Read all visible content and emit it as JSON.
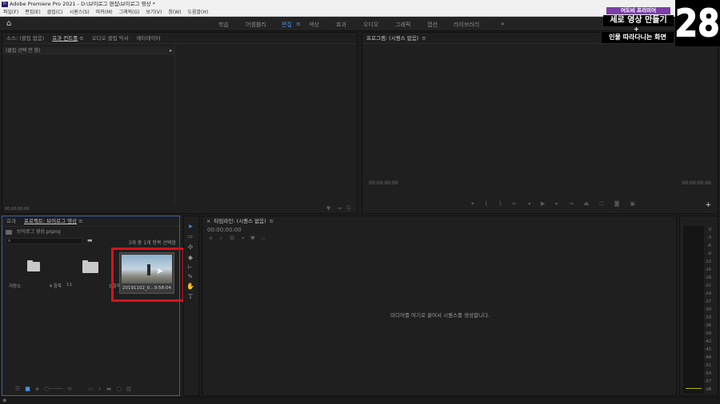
{
  "window": {
    "title": "Adobe Premiere Pro 2021 - D:\\브이로그 편집\\브이로그 영상 *"
  },
  "menu": [
    "파일(F)",
    "편집(E)",
    "클립(C)",
    "시퀀스(S)",
    "마커(M)",
    "그래픽(G)",
    "보기(V)",
    "창(W)",
    "도움말(H)"
  ],
  "workspaces": [
    "학습",
    "어셈블리",
    "편집",
    "색상",
    "효과",
    "오디오",
    "그래픽",
    "캡션",
    "라이브러리"
  ],
  "workspace_active": "편집",
  "workspace_more": "»",
  "source_panel": {
    "tabs": [
      "소스: (클립 없음)",
      "효과 컨트롤",
      "오디오 클립 믹서",
      "메타데이터"
    ],
    "active_tab": "효과 컨트롤",
    "no_clip": "(클립 선택 안 함)",
    "timecode": "00:00:00:00"
  },
  "program_panel": {
    "title": "프로그램: (시퀀스 없음)",
    "timecode_left": "00:00:00:00",
    "timecode_right": "00:00:00:00"
  },
  "project_panel": {
    "tabs": [
      "효과",
      "프로젝트: 브이로그 영상"
    ],
    "project_file": "브이로그 영상.prproj",
    "selection_info": "3개 중 1개 항목 선택함",
    "items": [
      {
        "name": "저장소",
        "meta": "4 항목",
        "kind": "folder"
      },
      {
        "name": "11",
        "meta": "3 항목",
        "kind": "folder"
      },
      {
        "name": "20191102_0...",
        "meta": "9:58:04",
        "kind": "clip"
      }
    ]
  },
  "timeline_panel": {
    "title": "타임라인: (시퀀스 없음)",
    "timecode": "00:00:00:00",
    "drop_hint": "미디어를 여기로 끌어서 시퀀스를 생성합니다."
  },
  "audio_meter": {
    "ticks": [
      "0",
      "-3",
      "-6",
      "-9",
      "-12",
      "-15",
      "-18",
      "-21",
      "-24",
      "-27",
      "-30",
      "-33",
      "-36",
      "-39",
      "-42",
      "-45",
      "-48",
      "-51",
      "-54",
      "-57",
      "dB"
    ]
  },
  "overlay": {
    "subtitle": "어도비 프리미어",
    "line1": "세로 영상 만들기",
    "plus": "+",
    "line2": "인물 따라다니는 화면",
    "number": "28"
  },
  "colors": {
    "accent": "#4a8fe0",
    "highlight_box": "#d4141c",
    "panel_select": "#3a5ea8"
  }
}
